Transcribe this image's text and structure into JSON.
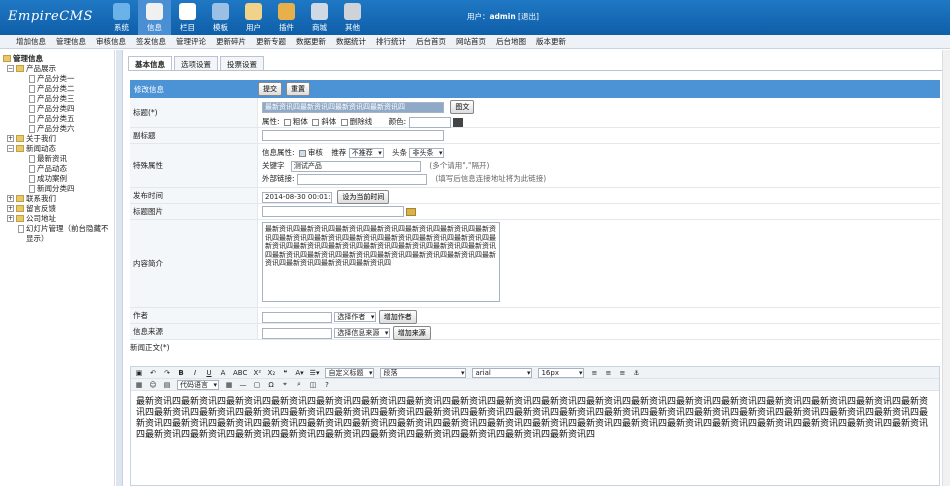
{
  "app": {
    "logo": "EmpireCMS"
  },
  "topnav": [
    {
      "label": "系统",
      "color": "#6bb2e8"
    },
    {
      "label": "信息",
      "color": "#f0f0f0"
    },
    {
      "label": "栏目",
      "color": "#ffffff"
    },
    {
      "label": "模板",
      "color": "#9ac0e6"
    },
    {
      "label": "用户",
      "color": "#f0d28a"
    },
    {
      "label": "插件",
      "color": "#e8b04a"
    },
    {
      "label": "商城",
      "color": "#cfd9e6"
    },
    {
      "label": "其他",
      "color": "#cfd3d9"
    }
  ],
  "user": {
    "prefix": "用户：",
    "name": "admin",
    "logout": "[退出]"
  },
  "menu": [
    "增加信息",
    "管理信息",
    "审核信息",
    "签发信息",
    "管理评论",
    "更新碎片",
    "更新专题",
    "数据更新",
    "数据统计",
    "排行统计",
    "后台首页",
    "网站首页",
    "后台地图",
    "版本更新"
  ],
  "tree": [
    {
      "label": "管理信息",
      "kind": "root"
    },
    {
      "label": "产品展示",
      "kind": "folder",
      "pm": "−",
      "indent": 0
    },
    {
      "label": "产品分类一",
      "kind": "doc",
      "indent": 2
    },
    {
      "label": "产品分类二",
      "kind": "doc",
      "indent": 2
    },
    {
      "label": "产品分类三",
      "kind": "doc",
      "indent": 2
    },
    {
      "label": "产品分类四",
      "kind": "doc",
      "indent": 2
    },
    {
      "label": "产品分类五",
      "kind": "doc",
      "indent": 2
    },
    {
      "label": "产品分类六",
      "kind": "doc",
      "indent": 2
    },
    {
      "label": "关于我们",
      "kind": "folder",
      "pm": "+",
      "indent": 0
    },
    {
      "label": "新闻动态",
      "kind": "folder",
      "pm": "−",
      "indent": 0
    },
    {
      "label": "最新资讯",
      "kind": "doc",
      "indent": 2
    },
    {
      "label": "产品动态",
      "kind": "doc",
      "indent": 2
    },
    {
      "label": "成功案例",
      "kind": "doc",
      "indent": 2
    },
    {
      "label": "新闻分类四",
      "kind": "doc",
      "indent": 2
    },
    {
      "label": "联系我们",
      "kind": "folder",
      "pm": "+",
      "indent": 0
    },
    {
      "label": "留言反馈",
      "kind": "folder",
      "pm": "+",
      "indent": 0
    },
    {
      "label": "公司地址",
      "kind": "folder",
      "pm": "+",
      "indent": 0
    },
    {
      "label": "幻灯片管理（前台隐藏不显示）",
      "kind": "doc",
      "indent": 1
    }
  ],
  "tabs": [
    "基本信息",
    "选项设置",
    "投票设置"
  ],
  "form": {
    "header": "修改信息",
    "submit": "提交",
    "reset": "重置",
    "title_label": "标题(*)",
    "title_value": "最新资讯四最新资讯四最新资讯四最新资讯四",
    "title_btn": "图文",
    "attr_label": "属性:",
    "bold": "粗体",
    "italic": "斜体",
    "strike": "删除线",
    "color_label": "颜色:",
    "subtitle_label": "副标题",
    "special_label": "特殊属性",
    "info_attr": "信息属性:",
    "audit": "审核",
    "recommend": "推荐",
    "recommend_val": "不推荐",
    "headline": "头条",
    "headline_val": "非头条",
    "keywords_label": "关键字",
    "keywords_value": "测试产品",
    "keywords_hint": "(多个请用\",\"隔开)",
    "link_label": "外部链接:",
    "link_hint": "(填写后信息连接地址将为此链接)",
    "time_label": "发布时间",
    "time_value": "2014-08-30 00:01:22",
    "time_btn": "设为当前时间",
    "img_label": "标题图片",
    "intro_label": "内容简介",
    "intro_value": "最新资讯四最新资讯四最新资讯四最新资讯四最新资讯四最新资讯四最新资讯四最新资讯四最新资讯四最新资讯四最新资讯四最新资讯四最新资讯四最新资讯四最新资讯四最新资讯四最新资讯四最新资讯四最新资讯四最新资讯四最新资讯四最新资讯四最新资讯四最新资讯四最新资讯四最新资讯四最新资讯四最新资讯四最新资讯四最新资讯四",
    "author_label": "作者",
    "author_select": "选择作者",
    "author_btn": "增加作者",
    "source_label": "信息来源",
    "source_select": "选择信息来源",
    "source_btn": "增加来源",
    "body_label": "新闻正文(*)"
  },
  "editor": {
    "format": "自定义标题",
    "para": "段落",
    "font": "arial",
    "size": "16px",
    "code": "代码语言",
    "content": "最新资讯四最新资讯四最新资讯四最新资讯四最新资讯四最新资讯四最新资讯四最新资讯四最新资讯四最新资讯四最新资讯四最新资讯四最新资讯四最新资讯四最新资讯四最新资讯四最新资讯四最新资讯四最新资讯四最新资讯四最新资讯四最新资讯四最新资讯四最新资讯四最新资讯四最新资讯四最新资讯四最新资讯四最新资讯四最新资讯四最新资讯四最新资讯四最新资讯四最新资讯四最新资讯四最新资讯四最新资讯四最新资讯四最新资讯四最新资讯四最新资讯四最新资讯四最新资讯四最新资讯四最新资讯四最新资讯四最新资讯四最新资讯四最新资讯四最新资讯四最新资讯四最新资讯四最新资讯四最新资讯四最新资讯四最新资讯四最新资讯四最新资讯四最新资讯四最新资讯四最新资讯四最新资讯四最新资讯四"
  }
}
